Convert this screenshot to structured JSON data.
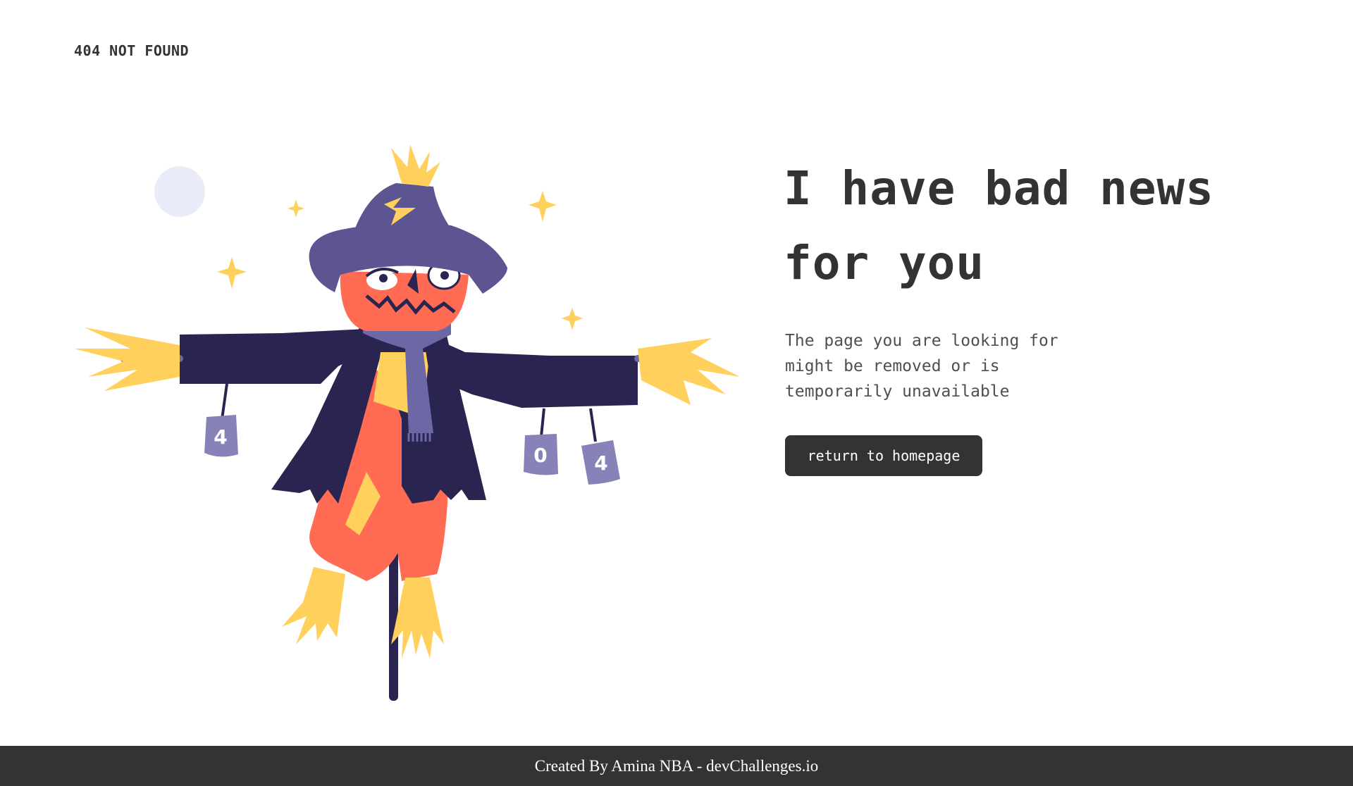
{
  "header": {
    "brand": "404 NOT FOUND"
  },
  "main": {
    "headline": "I have bad news for you",
    "message": "The page you are looking for might be removed or is temporarily unavailable",
    "button_label": "return to homepage",
    "can_labels": [
      "4",
      "0",
      "4"
    ]
  },
  "footer": {
    "text": "Created By Amina NBA - devChallenges.io"
  },
  "colors": {
    "dark": "#333333",
    "accent_yellow": "#FFD05B",
    "hat_purple": "#5C5592",
    "coat_navy": "#2A2550",
    "pumpkin_orange": "#FF6B53",
    "moon": "#E9ECF7"
  }
}
